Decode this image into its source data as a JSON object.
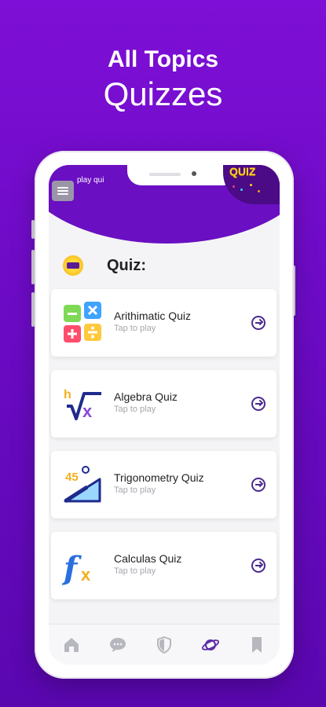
{
  "promo": {
    "line1": "All Topics",
    "line2": "Quizzes"
  },
  "app": {
    "title": "play qui",
    "logo_text": "QUIZ"
  },
  "section": {
    "title": "Quiz:"
  },
  "quizzes": [
    {
      "name": "Arithimatic Quiz",
      "subtitle": "Tap to play",
      "icon": "arithmetic-icon"
    },
    {
      "name": "Algebra Quiz",
      "subtitle": "Tap to play",
      "icon": "algebra-icon"
    },
    {
      "name": "Trigonometry Quiz",
      "subtitle": "Tap to play",
      "icon": "trigonometry-icon"
    },
    {
      "name": "Calculas Quiz",
      "subtitle": "Tap to play",
      "icon": "calculus-icon"
    }
  ],
  "nav": [
    {
      "icon": "home-icon",
      "active": false
    },
    {
      "icon": "chat-icon",
      "active": false
    },
    {
      "icon": "shield-icon",
      "active": false
    },
    {
      "icon": "planet-icon",
      "active": true
    },
    {
      "icon": "bookmark-icon",
      "active": false
    }
  ],
  "colors": {
    "background": "#6d0bc6",
    "header": "#6a0fc2",
    "accent": "#4a2b8f",
    "active_nav": "#5b2aa8",
    "inactive_nav": "#b7b7bf"
  }
}
